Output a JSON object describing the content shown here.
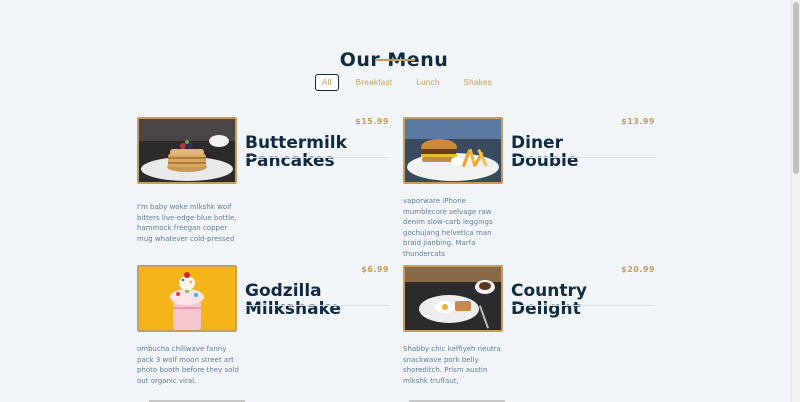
{
  "section": {
    "title": "Our Menu"
  },
  "filters": [
    {
      "label": "All",
      "active": true
    },
    {
      "label": "Breakfast",
      "active": false
    },
    {
      "label": "Lunch",
      "active": false
    },
    {
      "label": "Shakes",
      "active": false
    }
  ],
  "items": [
    {
      "name": "Buttermilk Pancakes",
      "price": "$15.99",
      "desc": "I'm baby woke mlkshk wolf bitters live-edge blue bottle, hammock freegan copper mug whatever cold-pressed"
    },
    {
      "name": "Diner Double",
      "price": "$13.99",
      "desc": "vaporware iPhone mumblecore selvage raw denim slow-carb leggings gochujang helvetica man braid jianbing. Marfa thundercats"
    },
    {
      "name": "Godzilla Milkshake",
      "price": "$6.99",
      "desc": "ombucha chillwave fanny pack 3 wolf moon street art photo booth before they sold out organic viral."
    },
    {
      "name": "Country Delight",
      "price": "$20.99",
      "desc": "Shabby chic keffiyeh neutra snackwave pork belly shoreditch. Prism austin mlkshk truffaut,"
    }
  ],
  "colors": {
    "accent": "#c59d5f",
    "heading": "#102a42",
    "body": "#617d98",
    "background": "#f1f5f8"
  }
}
